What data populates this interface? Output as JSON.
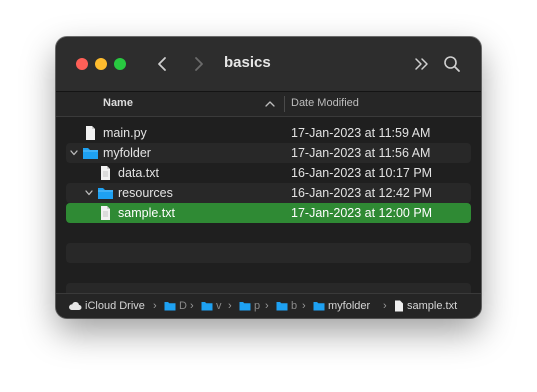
{
  "window": {
    "title": "basics"
  },
  "columns": {
    "name": "Name",
    "date": "Date Modified"
  },
  "files": [
    {
      "name": "main.py",
      "date": "17-Jan-2023 at 11:59 AM",
      "type": "file",
      "depth": 0
    },
    {
      "name": "myfolder",
      "date": "17-Jan-2023 at 11:56 AM",
      "type": "folder",
      "depth": 0,
      "expanded": true
    },
    {
      "name": "data.txt",
      "date": "16-Jan-2023 at 10:17 PM",
      "type": "file",
      "depth": 1
    },
    {
      "name": "resources",
      "date": "16-Jan-2023 at 12:42 PM",
      "type": "folder",
      "depth": 1,
      "expanded": true
    },
    {
      "name": "sample.txt",
      "date": "17-Jan-2023 at 12:00 PM",
      "type": "file",
      "depth": 1,
      "selected": true
    }
  ],
  "pathbar": {
    "root": "iCloud Drive",
    "truncated": [
      "D",
      "v",
      "p",
      "b"
    ],
    "folder": "myfolder",
    "file": "sample.txt"
  },
  "colors": {
    "selection": "#2f8a34",
    "folder": "#1ea1f2",
    "close": "#fe5f57",
    "minimize": "#febc2e",
    "zoom": "#28c840"
  }
}
